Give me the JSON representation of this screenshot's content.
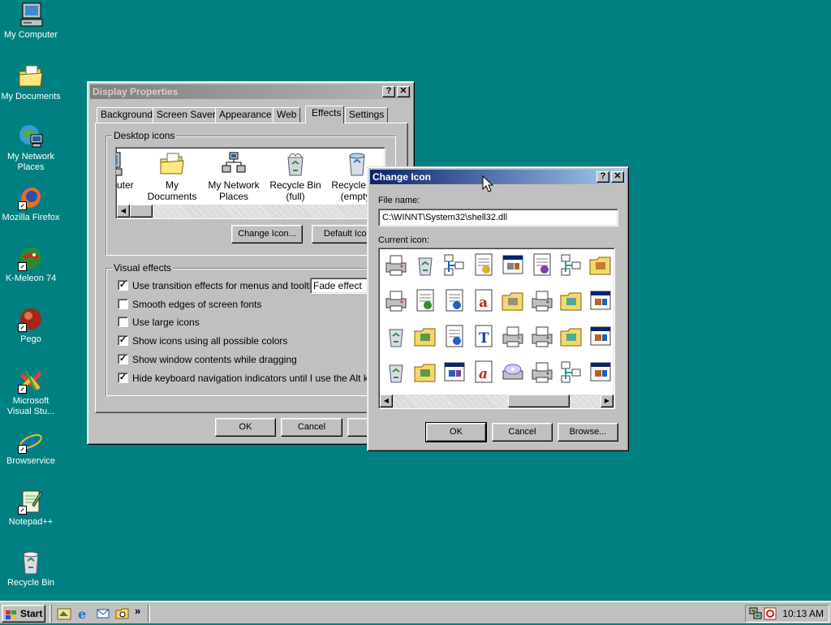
{
  "desktop": {
    "icons": [
      {
        "label": "My Computer",
        "icon": "computer-icon"
      },
      {
        "label": "My Documents",
        "icon": "documents-folder-icon"
      },
      {
        "label": "My Network Places",
        "icon": "network-icon"
      },
      {
        "label": "Mozilla Firefox",
        "icon": "firefox-icon"
      },
      {
        "label": "K-Meleon 74",
        "icon": "k-meleon-icon"
      },
      {
        "label": "Pego",
        "icon": "pego-icon"
      },
      {
        "label": "Microsoft Visual Stu...",
        "icon": "visual-studio-icon"
      },
      {
        "label": "Browservice",
        "icon": "ie-icon"
      },
      {
        "label": "Notepad++",
        "icon": "notepad-plus-icon"
      },
      {
        "label": "Recycle Bin",
        "icon": "recycle-bin-icon"
      }
    ]
  },
  "display_properties": {
    "title": "Display Properties",
    "tabs": [
      "Background",
      "Screen Saver",
      "Appearance",
      "Web",
      "Effects",
      "Settings"
    ],
    "active_tab": "Effects",
    "desktop_icons_group": "Desktop icons",
    "icon_list": [
      {
        "label": "puter",
        "icon": "computer-icon"
      },
      {
        "label": "My Documents",
        "icon": "documents-folder-icon"
      },
      {
        "label": "My Network Places",
        "icon": "network-icon"
      },
      {
        "label": "Recycle Bin (full)",
        "icon": "recycle-bin-full-icon"
      },
      {
        "label": "Recycle Bin (empty)",
        "icon": "recycle-bin-empty-icon"
      }
    ],
    "change_icon_button": "Change Icon...",
    "default_icon_button": "Default Icon",
    "visual_effects_group": "Visual effects",
    "effects": [
      {
        "label": "Use transition effects for menus and tooltips",
        "checked": true
      },
      {
        "label": "Smooth edges of screen fonts",
        "checked": false
      },
      {
        "label": "Use large icons",
        "checked": false
      },
      {
        "label": "Show icons using all possible colors",
        "checked": true
      },
      {
        "label": "Show window contents while dragging",
        "checked": true
      },
      {
        "label": "Hide keyboard navigation indicators until I use the Alt key",
        "checked": true
      }
    ],
    "transition_select_value": "Fade effect",
    "ok": "OK",
    "cancel": "Cancel"
  },
  "change_icon": {
    "title": "Change Icon",
    "file_name_label": "File name:",
    "file_name_value": "C:\\WINNT\\System32\\shell32.dll",
    "current_icon_label": "Current icon:",
    "ok": "OK",
    "cancel": "Cancel",
    "browse": "Browse...",
    "icons": [
      "printer-icon",
      "recycle-bin-icon",
      "network-settings-icon",
      "gear-document-icon",
      "window-hourglass-icon",
      "program-group-icon",
      "tree-view-icon",
      "folder-network-icon",
      "network-printer-icon",
      "document-arrows-icon",
      "text-document-icon",
      "font-a-icon",
      "folder-error-icon",
      "printer-check-icon",
      "folder-open-icon",
      "control-panel-icon",
      "recycle-doc-icon",
      "folder-pen-icon",
      "notepad-icon",
      "truetype-font-icon",
      "fax-printer-icon",
      "printer-check-2-icon",
      "folder-star-icon",
      "calculator-window-icon",
      "recycle-full-icon",
      "folder-blue-icon",
      "window-gear-icon",
      "font-a-italic-icon",
      "cd-drive-icon",
      "printer-network-check-icon",
      "list-arrow-icon",
      "globe-window-icon"
    ]
  },
  "taskbar": {
    "start": "Start",
    "quick_launch": [
      "show-desktop-icon",
      "ie-icon",
      "outlook-icon",
      "folder-search-icon"
    ],
    "chevron": "»",
    "clock": "10:13 AM",
    "tray_icons": [
      "network-tray-icon",
      "antivirus-tray-icon"
    ]
  },
  "colors": {
    "desktop": "#008080",
    "active_title_start": "#0a246a",
    "active_title_end": "#a6caf0",
    "inactive_title": "#808080",
    "face": "#c0c0c0"
  }
}
